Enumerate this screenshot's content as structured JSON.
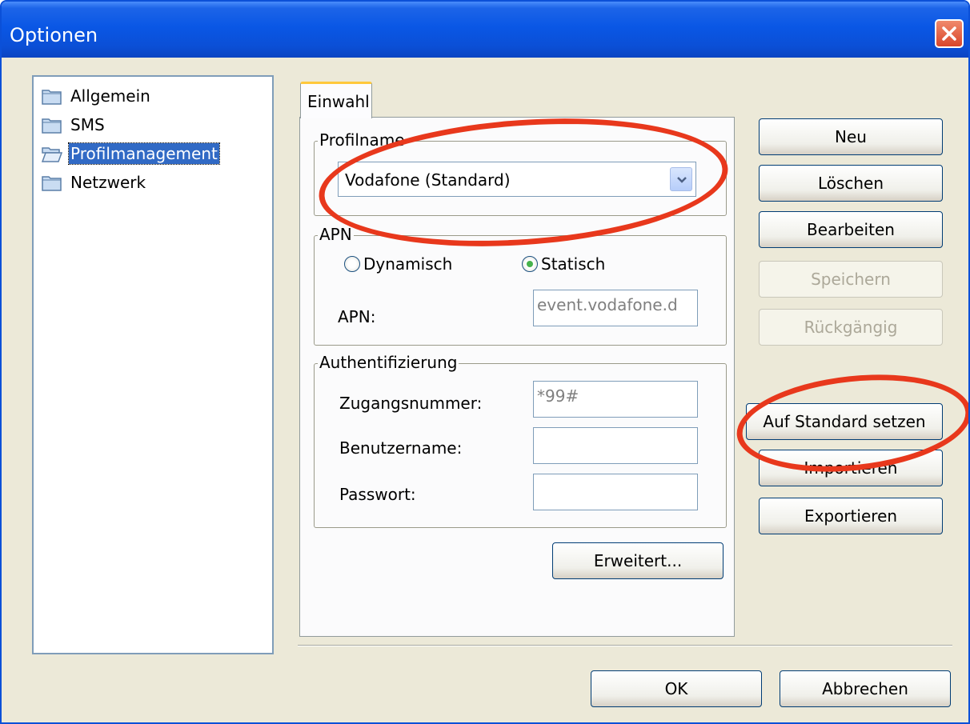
{
  "window": {
    "title": "Optionen"
  },
  "colors": {
    "titlebar": "#0a57e5",
    "selection": "#316ac5",
    "annotation": "#e8381c",
    "tab_highlight": "#ffc83c"
  },
  "sidebar": {
    "items": [
      {
        "label": "Allgemein",
        "icon": "folder-icon",
        "selected": false
      },
      {
        "label": "SMS",
        "icon": "folder-icon",
        "selected": false
      },
      {
        "label": "Profilmanagement",
        "icon": "folder-open-icon",
        "selected": true
      },
      {
        "label": "Netzwerk",
        "icon": "folder-icon",
        "selected": false
      }
    ]
  },
  "tabs": [
    {
      "label": "Einwahl",
      "active": true
    }
  ],
  "profilname": {
    "group_label": "Profilname",
    "selected": "Vodafone (Standard)"
  },
  "apn": {
    "group_label": "APN",
    "radio_dynamic": "Dynamisch",
    "radio_static": "Statisch",
    "selected": "Statisch",
    "field_label": "APN:",
    "field_value": "event.vodafone.d"
  },
  "auth": {
    "group_label": "Authentifizierung",
    "zugang_label": "Zugangsnummer:",
    "zugang_value": "*99#",
    "user_label": "Benutzername:",
    "user_value": "",
    "pass_label": "Passwort:",
    "pass_value": ""
  },
  "buttons": {
    "erweitert": "Erweitert...",
    "neu": "Neu",
    "loeschen": "Löschen",
    "bearbeiten": "Bearbeiten",
    "speichern": "Speichern",
    "rueckgaengig": "Rückgängig",
    "standard": "Auf Standard setzen",
    "importieren": "Importieren",
    "exportieren": "Exportieren",
    "ok": "OK",
    "abbrechen": "Abbrechen"
  }
}
